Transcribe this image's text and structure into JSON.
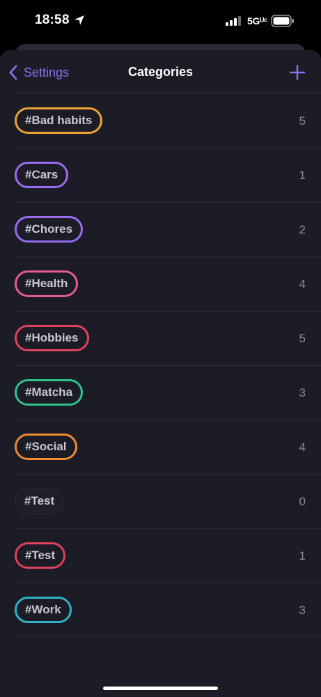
{
  "status_bar": {
    "time": "18:58",
    "network": "5Gᵁᶜ"
  },
  "nav": {
    "back_label": "Settings",
    "title": "Categories"
  },
  "categories": [
    {
      "label": "#Bad habits",
      "count": "5",
      "color": "#f0a533"
    },
    {
      "label": "#Cars",
      "count": "1",
      "color": "#9a6cf0"
    },
    {
      "label": "#Chores",
      "count": "2",
      "color": "#9a6cf0"
    },
    {
      "label": "#Health",
      "count": "4",
      "color": "#e65c8f"
    },
    {
      "label": "#Hobbies",
      "count": "5",
      "color": "#e0415d"
    },
    {
      "label": "#Matcha",
      "count": "3",
      "color": "#2fc48a"
    },
    {
      "label": "#Social",
      "count": "4",
      "color": "#f08a33"
    },
    {
      "label": "#Test",
      "count": "0",
      "color": ""
    },
    {
      "label": "#Test",
      "count": "1",
      "color": "#e0415d"
    },
    {
      "label": "#Work",
      "count": "3",
      "color": "#2fb3c4"
    }
  ],
  "colors": {
    "accent": "#8a72f0",
    "background": "#1c1c26",
    "divider": "#2c2c38"
  }
}
